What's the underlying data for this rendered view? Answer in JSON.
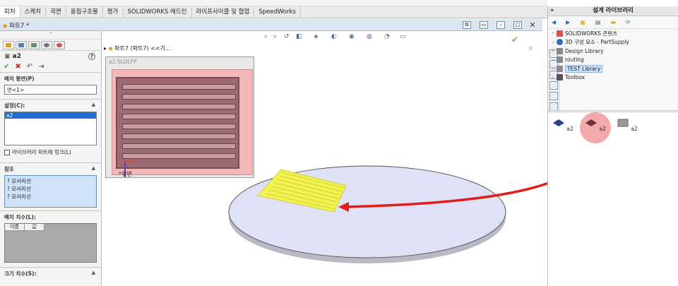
{
  "tabs": [
    "피처",
    "스케치",
    "곡면",
    "용접구조물",
    "평가",
    "SOLIDWORKS 애드인",
    "라이프사이클 및 협업",
    "SpeedWorks"
  ],
  "document": {
    "title": "파트7 *"
  },
  "property_manager": {
    "feature_name": "a2",
    "help": "?",
    "sections": {
      "placement_plane": {
        "title": "배치 평면(P)",
        "value": "면<1>"
      },
      "configuration": {
        "title": "설정(C):",
        "items": [
          "a2"
        ],
        "selected": "a2"
      },
      "link_checkbox": {
        "label": "라이브러리 파트에 링크(L)",
        "checked": false
      },
      "references": {
        "title": "참조",
        "items": [
          "? 모서리선",
          "? 모서리선",
          "? 모서리선"
        ]
      },
      "placement_dims": {
        "title": "배치 치수(L):",
        "columns": [
          "이름",
          "값"
        ]
      },
      "size_dims": {
        "title": "크기 치수(S):"
      }
    }
  },
  "graphics": {
    "tree_label": "파트7  (파트7) <<기...",
    "preview_title": "a2.SLDLFP",
    "origin_label": "*윗면"
  },
  "task_pane": {
    "title": "설계 라이브러리",
    "library_items": [
      {
        "label": "SOLIDWORKS 콘텐츠",
        "icon": "solidworks-content-icon"
      },
      {
        "label": "3D 구성 요소 - PartSupply",
        "icon": "partsupply-icon"
      },
      {
        "label": "Design Library",
        "icon": "design-library-icon"
      },
      {
        "label": "routing",
        "icon": "routing-icon"
      },
      {
        "label": "TEST Library",
        "icon": "folder-icon"
      },
      {
        "label": "Toolbox",
        "icon": "toolbox-icon"
      }
    ],
    "selected_library": "TEST Library",
    "thumbnails": [
      "a2",
      "a2",
      "a2"
    ]
  },
  "colors": {
    "accent": "#1f6fd0",
    "arrow": "#e21d1d",
    "plate": "#dfe1f7",
    "feature": "#f2f257",
    "preview_bg": "#f3b7b8"
  }
}
